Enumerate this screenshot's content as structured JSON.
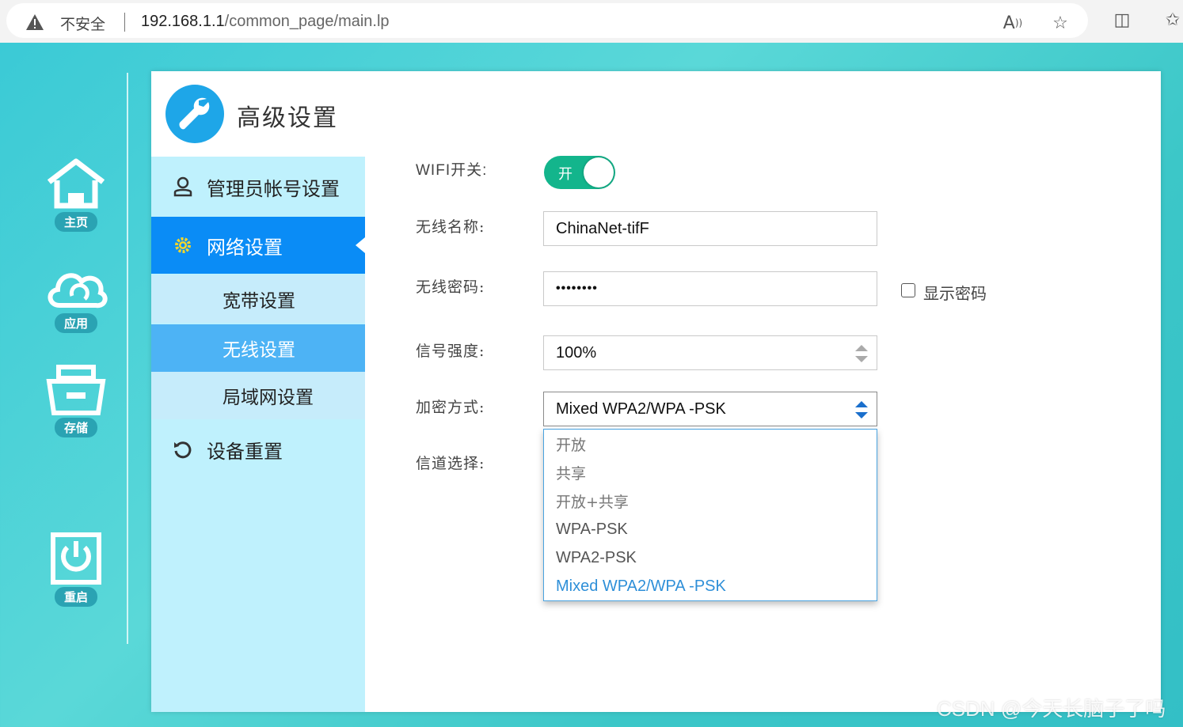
{
  "browser": {
    "security_label": "不安全",
    "url_host": "192.168.1.1",
    "url_path": "/common_page/main.lp",
    "icons": [
      "read-aloud-icon",
      "favorite-star-icon",
      "split-screen-icon",
      "favorites-icon"
    ]
  },
  "rail": {
    "items": [
      {
        "label": "主页",
        "icon": "home-icon"
      },
      {
        "label": "应用",
        "icon": "cloud-icon"
      },
      {
        "label": "存储",
        "icon": "storage-icon"
      },
      {
        "label": "重启",
        "icon": "power-icon"
      }
    ]
  },
  "sidebar": {
    "title": "高级设置",
    "menu": [
      {
        "label": "管理员帐号设置",
        "icon": "user-icon"
      },
      {
        "label": "网络设置",
        "icon": "gear-icon"
      },
      {
        "label": "设备重置",
        "icon": "reset-icon"
      }
    ],
    "submenu": [
      {
        "label": "宽带设置"
      },
      {
        "label": "无线设置"
      },
      {
        "label": "局域网设置"
      }
    ]
  },
  "form": {
    "wifi_switch_label": "WIFI开关:",
    "wifi_switch_state": "开",
    "ssid_label": "无线名称:",
    "ssid_value": "ChinaNet-tifF",
    "password_label": "无线密码:",
    "password_value": "••••••••",
    "show_password_label": "显示密码",
    "signal_label": "信号强度:",
    "signal_value": "100%",
    "encryption_label": "加密方式:",
    "encryption_value": "Mixed WPA2/WPA -PSK",
    "channel_label": "信道选择:",
    "encryption_options": [
      "开放",
      "共享",
      "开放+共享",
      "WPA-PSK",
      "WPA2-PSK",
      "Mixed WPA2/WPA -PSK"
    ]
  },
  "watermark": "CSDN @今天长脑子了吗",
  "colors": {
    "accent": "#0a8cf6",
    "toggle_on": "#13b58c",
    "sidebar_bg": "#bff1fd"
  }
}
